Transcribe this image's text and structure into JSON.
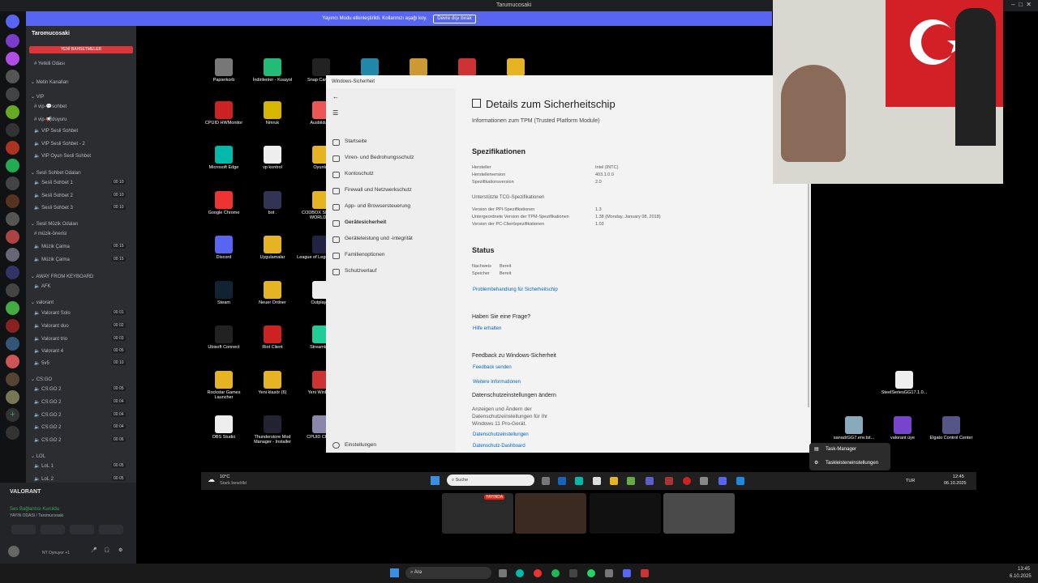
{
  "app": {
    "title": "Tarumucosaki"
  },
  "banner": {
    "text": "Yayıncı Modu etkinleştirildi. Kollarınızı aşağı koy.",
    "button": "Devre dışı bırak"
  },
  "discord": {
    "server_name": "Taromucosaki",
    "new_events": "YENİ BAHSETMELER",
    "channels": [
      {
        "label": "Yetkili Odası",
        "icon": "#"
      },
      {
        "label": "Metin Kanalları",
        "icon": "v"
      },
      {
        "label": "VIP",
        "icon": "v"
      },
      {
        "label": "vip-💬sohbet",
        "icon": "#"
      },
      {
        "label": "vip-📢duyuru",
        "icon": "#"
      },
      {
        "label": "VIP Sesli Sohbet",
        "icon": "🔊"
      },
      {
        "label": "VIP Sesli Sohbet - 2",
        "icon": "🔊"
      },
      {
        "label": "VIP Oyun Sesli Sohbet",
        "icon": "🔊"
      },
      {
        "label": "Sesli Sohbet Odaları",
        "icon": "v"
      },
      {
        "label": "Sesli Sohbet 1",
        "icon": "🔊",
        "count": "00 10"
      },
      {
        "label": "Sesli Sohbet 2",
        "icon": "🔊",
        "count": "00 10"
      },
      {
        "label": "Sesli Sohbet 3",
        "icon": "🔊",
        "count": "00 10"
      },
      {
        "label": "Sesli Müzik Odaları",
        "icon": "v"
      },
      {
        "label": "müzik-önerisi",
        "icon": "#"
      },
      {
        "label": "Müzik Çalma",
        "icon": "🔊",
        "count": "00 15"
      },
      {
        "label": "Müzik Çalma",
        "icon": "🔊",
        "count": "00 15"
      },
      {
        "label": "AWAY FROM KEYBOARD",
        "icon": "v"
      },
      {
        "label": "AFK",
        "icon": "🔊"
      },
      {
        "label": "valorant",
        "icon": "v"
      },
      {
        "label": "Valorant Solo",
        "icon": "🔊",
        "count": "00 01"
      },
      {
        "label": "Valorant duo",
        "icon": "🔊",
        "count": "00 02"
      },
      {
        "label": "Valorant trio",
        "icon": "🔊",
        "count": "00 03"
      },
      {
        "label": "Valorant 4",
        "icon": "🔊",
        "count": "00 05"
      },
      {
        "label": "5v5",
        "icon": "🔊",
        "count": "00 10"
      },
      {
        "label": "CS:GO",
        "icon": "v"
      },
      {
        "label": "CS:GO 2",
        "icon": "🔊",
        "count": "00 05"
      },
      {
        "label": "CS:GO 2",
        "icon": "🔊",
        "count": "00 04"
      },
      {
        "label": "CS:GO 2",
        "icon": "🔊",
        "count": "00 04"
      },
      {
        "label": "CS:GO 2",
        "icon": "🔊",
        "count": "00 04"
      },
      {
        "label": "CS:GO 2",
        "icon": "🔊",
        "count": "00 06"
      },
      {
        "label": "LOL",
        "icon": "v"
      },
      {
        "label": "LoL 1",
        "icon": "🔊",
        "count": "00 05"
      },
      {
        "label": "LoL 2",
        "icon": "🔊",
        "count": "00 05"
      }
    ],
    "activity": "VALORANT",
    "voice_status": "Ses Bağlantısı Kuruldu",
    "voice_channel": "YAYIN ODASI / Taromucosaki",
    "user_status": "NT Oynuyor +1"
  },
  "desktop": {
    "icons": [
      "Papierkorb",
      "İndirilenler - Kısayol",
      "Snap Camera",
      "",
      "",
      "",
      "",
      "CPUID HWMonitor",
      "Nmruk",
      "Ausbildung",
      "Oyunlar",
      "Microsoft Edge",
      "vp kontrol",
      "Google Chrome",
      "bot .",
      "CODBOX SERVER WORLD AT",
      "Discord",
      "Uygulamalar",
      "League of Legends PBE",
      "Steam",
      "Neuer Ordner",
      "Outplayed",
      "Ubisoft Connect",
      "Riot Client",
      "Streamlabs",
      "Rockstar Games Launcher",
      "Yeni klasör (6)",
      "Yeni WinRAR",
      "OBS Studio",
      "Thunderstore Mod Manager - Installer",
      "CPUID CPU-Z",
      "SteelSeriesGG17.1.0...",
      "sanadrGG7.env.tst...",
      "valorant üye",
      "Elgato Control Center"
    ]
  },
  "security": {
    "window_title": "Windows-Sicherheit",
    "nav": [
      "Startseite",
      "Viren- und Bedrohungsschutz",
      "Kontoschutz",
      "Firewall und Netzwerkschutz",
      "App- und Browsersteuerung",
      "Gerätesicherheit",
      "Geräteleistung und -integrität",
      "Familienoptionen",
      "Schutzverlauf"
    ],
    "settings": "Einstellungen",
    "page_title": "Details zum Sicherheitschip",
    "page_subtitle": "Informationen zum TPM (Trusted Platform Module)",
    "spec_header": "Spezifikationen",
    "specs": [
      {
        "label": "Hersteller",
        "value": "Intel (INTC)"
      },
      {
        "label": "Herstellerversion",
        "value": "403.1.0.0"
      },
      {
        "label": "Spezifikationsversion",
        "value": "2.0"
      }
    ],
    "tcg_header": "Unterstützte TCG-Spezifikationen",
    "tcg": [
      {
        "label": "Version der PPI-Spezifikationen",
        "value": "1.3"
      },
      {
        "label": "Untergeordnete Version der TPM-Spezifikationen",
        "value": "1.38 (Monday, January 08, 2018)"
      },
      {
        "label": "Version der PC-Clientspezifikationen",
        "value": "1.03"
      }
    ],
    "status_header": "Status",
    "status": [
      {
        "label": "Nachweis",
        "value": "Bereit"
      },
      {
        "label": "Speicher",
        "value": "Bereit"
      }
    ],
    "troubleshoot": "Problembehandlung für Sicherheitschip",
    "question": "Haben Sie eine Frage?",
    "help": "Hilfe erhalten",
    "feedback_header": "Feedback zu Windows-Sicherheit",
    "feedback_link": "Feedback senden",
    "more_info": "Weitere Informationen",
    "privacy_header": "Datenschutzeinstellungen ändern",
    "privacy_text": "Anzeigen und Ändern der Datenschutzeinstellungen für Ihr Windows 11 Pro-Gerät.",
    "privacy_link1": "Datenschutzeinstellungen",
    "privacy_link2": "Datenschutz-Dashboard"
  },
  "context_menu": [
    "Task-Manager",
    "Taskleisteneinstellungen"
  ],
  "taskbar": {
    "weather_temp": "10°C",
    "weather_desc": "Stark bewölkt",
    "search": "Suche",
    "lang": "TUR",
    "time": "12:45",
    "date": "06.10.2025",
    "thumb_label": "YAYINDA"
  },
  "bottombar": {
    "search": "Ara",
    "time": "13:45",
    "date": "6.10.2025"
  }
}
